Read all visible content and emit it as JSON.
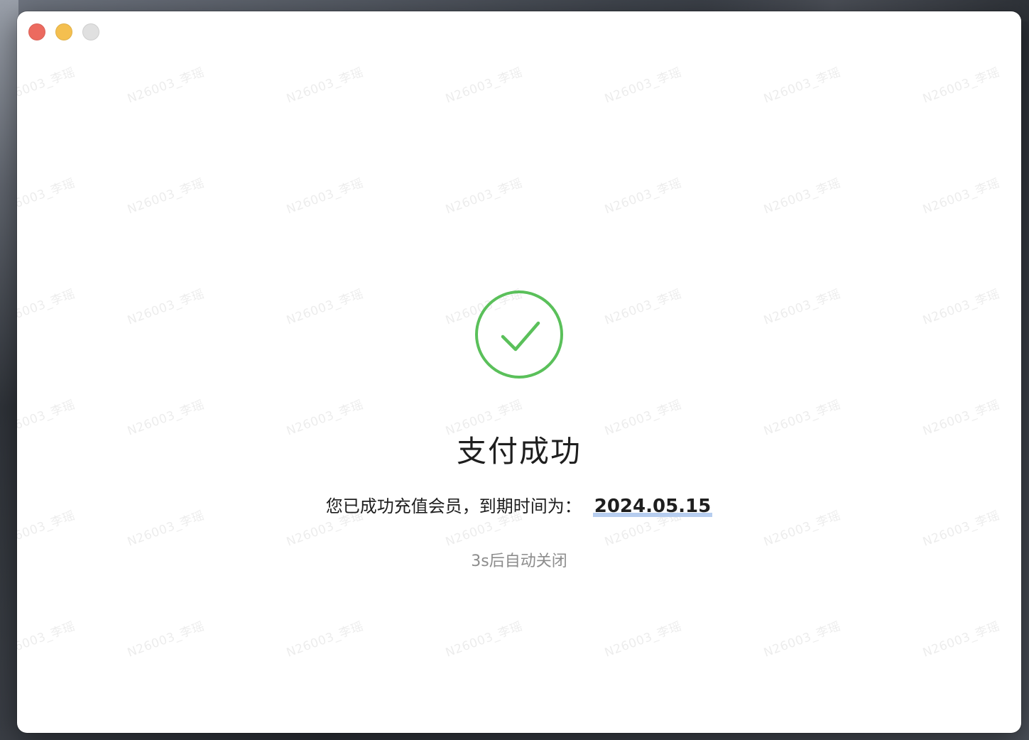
{
  "window": {
    "controls": {
      "close": "close",
      "minimize": "minimize",
      "maximize": "maximize"
    }
  },
  "watermark": "N26003_李瑶",
  "result": {
    "icon": "success-check-icon",
    "title": "支付成功",
    "message_prefix": "您已成功充值会员，到期时间为：",
    "expire_date": "2024.05.15",
    "countdown": "3s后自动关闭"
  },
  "colors": {
    "success": "#5ac05a",
    "close": "#ec6a5f",
    "minimize": "#f4bf4f",
    "maximize": "#e0e0e0",
    "date_highlight": "#b6cdef"
  }
}
